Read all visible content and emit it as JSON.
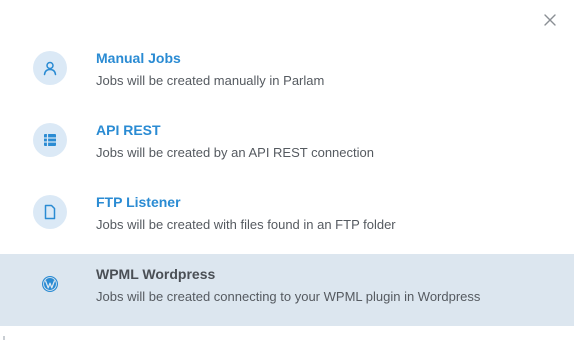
{
  "dialog": {
    "close_icon": "close-icon",
    "options": [
      {
        "title": "Manual Jobs",
        "description": "Jobs will be created manually in Parlam",
        "icon": "user-icon"
      },
      {
        "title": "API REST",
        "description": "Jobs will be created by an API REST connection",
        "icon": "server-icon"
      },
      {
        "title": "FTP Listener",
        "description": "Jobs will be created with files found in an FTP folder",
        "icon": "file-icon"
      },
      {
        "title": "WPML Wordpress",
        "description": "Jobs will be created connecting to your WPML plugin in Wordpress",
        "icon": "wordpress-icon",
        "selected": true
      }
    ]
  },
  "colors": {
    "accent": "#2a8bd3",
    "icon_bg": "#dbe9f6",
    "selected_bg": "#dce6ef",
    "text_muted": "#555a60"
  }
}
